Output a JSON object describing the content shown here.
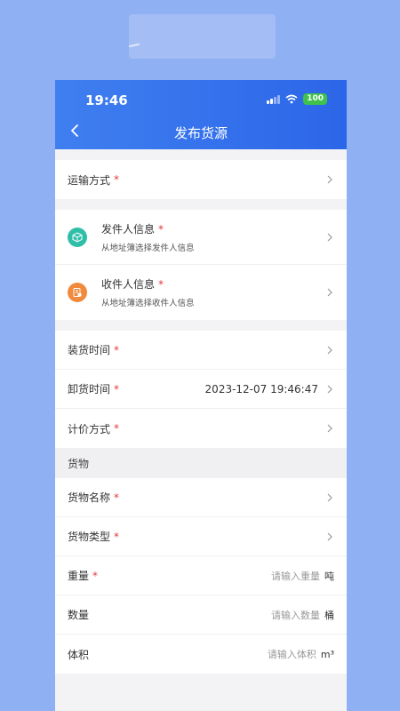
{
  "status": {
    "time": "19:46",
    "battery": "100"
  },
  "nav": {
    "title": "发布货源"
  },
  "transport": {
    "label": "运输方式"
  },
  "sender": {
    "title": "发件人信息",
    "subtitle": "从地址簿选择发件人信息"
  },
  "receiver": {
    "title": "收件人信息",
    "subtitle": "从地址簿选择收件人信息"
  },
  "times": {
    "loading": {
      "label": "装货时间",
      "value": ""
    },
    "unloading": {
      "label": "卸货时间",
      "value": "2023-12-07 19:46:47"
    },
    "pricing": {
      "label": "计价方式"
    }
  },
  "goods": {
    "section_title": "货物",
    "name": {
      "label": "货物名称"
    },
    "type": {
      "label": "货物类型"
    },
    "weight": {
      "label": "重量",
      "placeholder": "请输入重量",
      "unit": "吨"
    },
    "quantity": {
      "label": "数量",
      "placeholder": "请输入数量",
      "unit": "桶"
    },
    "volume": {
      "label": "体积",
      "placeholder": "请输入体积",
      "unit": "m³"
    }
  },
  "required_mark": "*",
  "colors": {
    "header": "#2c66e8",
    "required": "#e23b3b",
    "sender_icon": "#2fbfa8",
    "receiver_icon": "#f08a3c"
  }
}
